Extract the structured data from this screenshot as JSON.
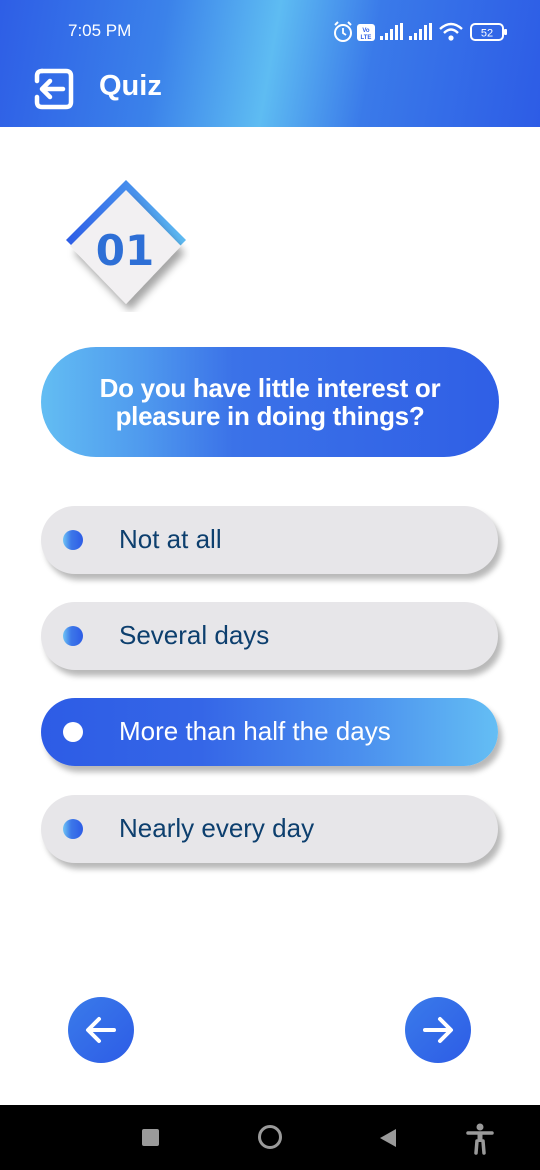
{
  "status_bar": {
    "time": "7:05 PM",
    "battery": "52",
    "icons": [
      "alarm-icon",
      "volte-icon",
      "signal-icon",
      "signal-icon",
      "wifi-icon",
      "battery-icon"
    ]
  },
  "header": {
    "title": "Quiz",
    "back_icon": "exit-arrow-icon"
  },
  "quiz": {
    "question_number": "01",
    "question_text": "Do you have little interest or pleasure in doing things?",
    "options": [
      {
        "label": "Not at all",
        "selected": false
      },
      {
        "label": "Several days",
        "selected": false
      },
      {
        "label": "More than half the days",
        "selected": true
      },
      {
        "label": "Nearly every day",
        "selected": false
      }
    ],
    "prev_icon": "arrow-left-icon",
    "next_icon": "arrow-right-icon"
  },
  "system_nav": {
    "buttons": [
      "recents-square-icon",
      "home-circle-icon",
      "back-triangle-icon",
      "accessibility-icon"
    ]
  },
  "colors": {
    "brand_blue": "#2d5ce6",
    "light_blue": "#5ebcf2",
    "option_bg": "#e7e6e9",
    "option_text": "#0d3f6e",
    "badge_text": "#2e6fd6"
  }
}
